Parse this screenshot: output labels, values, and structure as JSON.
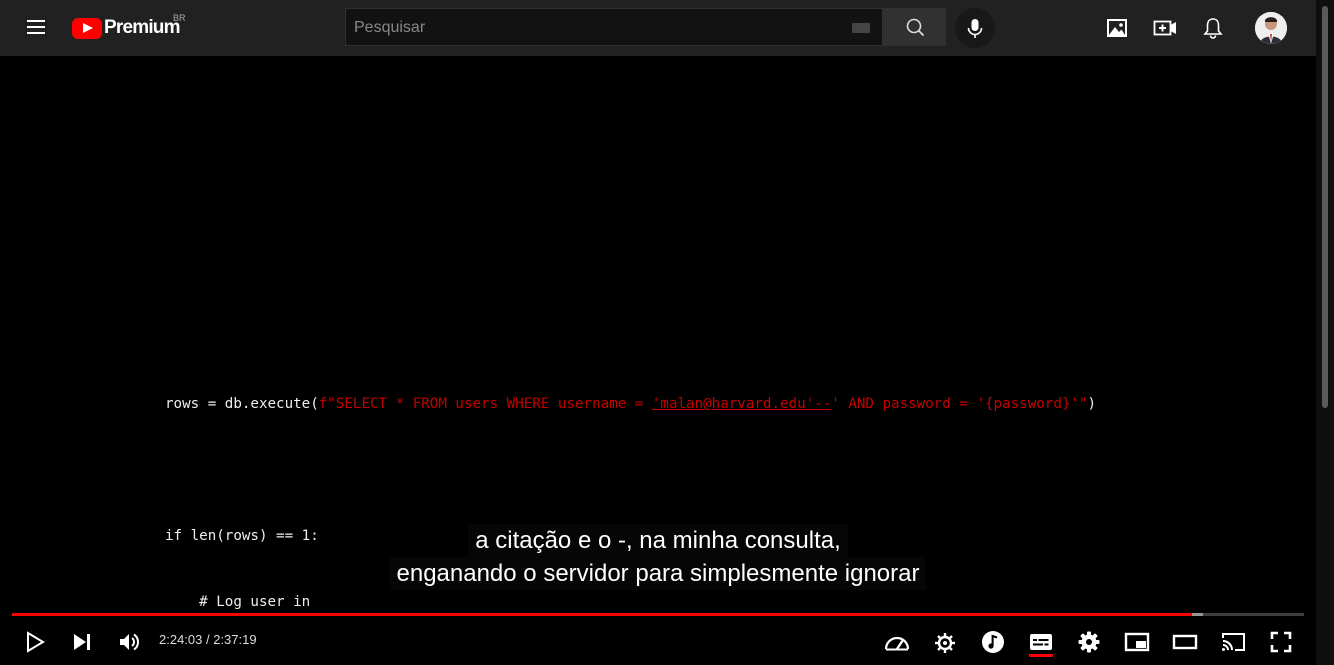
{
  "header": {
    "logo_text": "Premium",
    "country_code": "BR",
    "search_placeholder": "Pesquisar"
  },
  "video": {
    "code_lines": [
      {
        "plain": "rows = db.execute(",
        "red1": "f\"SELECT * FROM users WHERE username = ",
        "underlined": "'malan@harvard.edu'--",
        "red2": "' AND password = '{password}'\"",
        "tail": ")"
      },
      {
        "plain": "if len(rows) == 1:"
      },
      {
        "plain": "    # Log user in"
      }
    ],
    "captions": [
      "a citação e o -, na minha consulta,",
      "enganando o servidor para simplesmente ignorar"
    ]
  },
  "player": {
    "time_display": "2:24:03 / 2:37:19",
    "progress_played_fraction": 0.913,
    "progress_loaded_fraction": 0.922,
    "accent_color": "#ff0000"
  }
}
